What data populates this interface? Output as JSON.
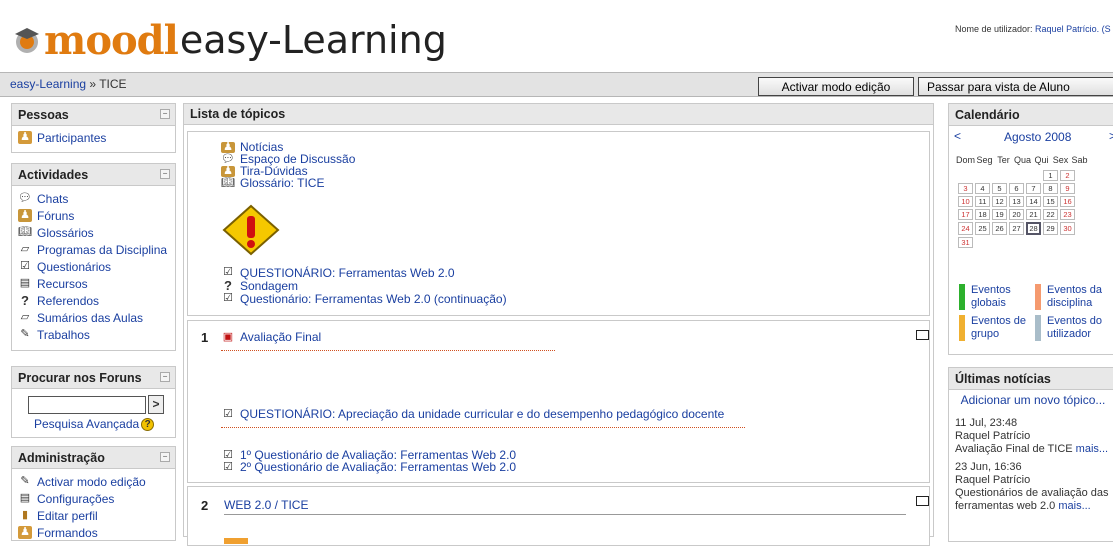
{
  "header": {
    "logo_part1": "moodl",
    "logo_part2": "easy-Learning",
    "user_prefix": "Nome de utilizador: ",
    "user_name": "Raquel Patrício. (S"
  },
  "navbar": {
    "home": "easy-Learning",
    "sep": " » ",
    "current": "TICE",
    "edit_button": "Activar modo edição",
    "student_button": "Passar para vista de Aluno"
  },
  "left": {
    "pessoas": {
      "title": "Pessoas",
      "items": [
        "Participantes"
      ]
    },
    "actividades": {
      "title": "Actividades",
      "items": [
        "Chats",
        "Fóruns",
        "Glossários",
        "Programas da Disciplina",
        "Questionários",
        "Recursos",
        "Referendos",
        "Sumários das Aulas",
        "Trabalhos"
      ]
    },
    "search": {
      "title": "Procurar nos Foruns",
      "button": ">",
      "advanced": "Pesquisa Avançada",
      "help": "?"
    },
    "admin": {
      "title": "Administração",
      "items": [
        "Activar modo edição",
        "Configurações",
        "Editar perfil",
        "Formandos"
      ]
    }
  },
  "main": {
    "title": "Lista de tópicos",
    "sec0": [
      "Notícias",
      "Espaço de Discussão",
      "Tira-Dúvidas",
      "Glossário: TICE"
    ],
    "sec0b": [
      "QUESTIONÁRIO: Ferramentas Web 2.0",
      "Sondagem",
      "Questionário: Ferramentas Web 2.0 (continuação)"
    ],
    "sec1": {
      "num": "1",
      "item1": "Avaliação Final",
      "item2": "QUESTIONÁRIO: Apreciação da unidade curricular e do desempenho pedagógico docente",
      "item3": "1º Questionário de Avaliação: Ferramentas Web 2.0",
      "item4": "2º Questionário de Avaliação: Ferramentas Web 2.0"
    },
    "sec2": {
      "num": "2",
      "title": "WEB 2.0 / TICE"
    }
  },
  "right": {
    "calendar": {
      "title": "Calendário",
      "prev": "<",
      "next": ">",
      "month": "Agosto 2008",
      "days": [
        "Dom",
        "Seg",
        "Ter",
        "Qua",
        "Qui",
        "Sex",
        "Sab"
      ],
      "weeks": [
        [
          "",
          "",
          "",
          "",
          "",
          "1",
          "2"
        ],
        [
          "3",
          "4",
          "5",
          "6",
          "7",
          "8",
          "9"
        ],
        [
          "10",
          "11",
          "12",
          "13",
          "14",
          "15",
          "16"
        ],
        [
          "17",
          "18",
          "19",
          "20",
          "21",
          "22",
          "23"
        ],
        [
          "24",
          "25",
          "26",
          "27",
          "28",
          "29",
          "30"
        ],
        [
          "31",
          "",
          "",
          "",
          "",
          "",
          ""
        ]
      ],
      "today": "28",
      "legend": [
        {
          "label": "Eventos globais",
          "color": "#2db02d"
        },
        {
          "label": "Eventos da disciplina",
          "color": "#f59a6f"
        },
        {
          "label": "Eventos de grupo",
          "color": "#f0b030"
        },
        {
          "label": "Eventos do utilizador",
          "color": "#a9bdc9"
        }
      ]
    },
    "news": {
      "title": "Últimas notícias",
      "add": "Adicionar um novo tópico...",
      "items": [
        {
          "date": "11 Jul, 23:48",
          "author": "Raquel Patrício",
          "text": "Avaliação Final de TICE",
          "more": "mais..."
        },
        {
          "date": "23 Jun, 16:36",
          "author": "Raquel Patrício",
          "text": "Questionários de avaliação das ferramentas web 2.0",
          "more": "mais..."
        }
      ]
    }
  }
}
